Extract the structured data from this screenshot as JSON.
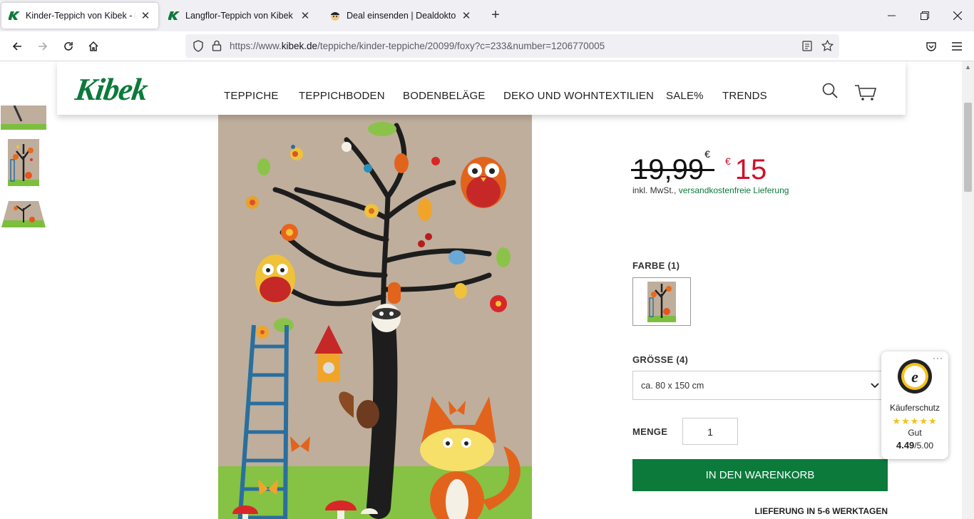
{
  "browser": {
    "tabs": [
      {
        "title": "Kinder-Teppich von Kibek - Foxy",
        "active": true
      },
      {
        "title": "Langflor-Teppich von Kibek - Do",
        "active": false
      },
      {
        "title": "Deal einsenden | Dealdoktor",
        "active": false
      }
    ],
    "url_prefix": "https://www.",
    "url_domain": "kibek.de",
    "url_path": "/teppiche/kinder-teppiche/20099/foxy?c=233&number=1206770005"
  },
  "site": {
    "logo": "Kibek",
    "menu": [
      "TEPPICHE",
      "TEPPICHBODEN",
      "BODENBELÄGE",
      "DEKO UND WOHNTEXTILIEN",
      "SALE%",
      "TRENDS"
    ]
  },
  "product": {
    "old_price": "19,99",
    "old_price_currency": "€",
    "new_price_currency": "€",
    "new_price": "15",
    "tax_note": "inkl. MwSt.,",
    "shipping_link": "versandkostenfreie Lieferung",
    "color_label": "FARBE (1)",
    "size_label": "GRÖSSE (4)",
    "size_selected": "ca. 80 x 150 cm",
    "qty_label": "MENGE",
    "qty_value": "1",
    "cart_button": "IN DEN WARENKORB",
    "delivery": "LIEFERUNG IN 5-6 WERKTAGEN"
  },
  "trusted_shops": {
    "label": "Käuferschutz",
    "stars": "★★★★★",
    "rating_word": "Gut",
    "score": "4.49",
    "max": "/5.00",
    "rating_fraction": 0.898
  },
  "colors": {
    "brand_green": "#0b7a3b",
    "price_red": "#d0102a"
  }
}
